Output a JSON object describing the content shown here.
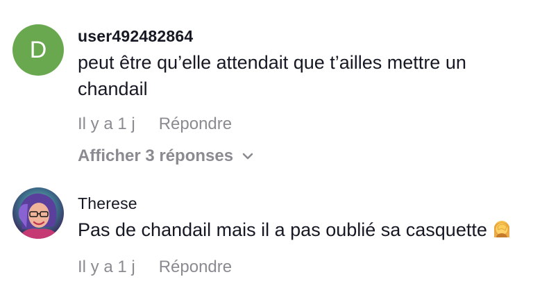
{
  "comments": [
    {
      "avatar_letter": "D",
      "avatar_color": "#6aa84f",
      "username": "user492482864",
      "text": "peut être qu’elle attendait que t’ailles mettre un chandail",
      "time": "Il y a 1 j",
      "reply_label": "Répondre",
      "view_replies": "Afficher 3 réponses",
      "replies_icon": "chevron-down-icon"
    },
    {
      "avatar_icon": "profile-photo",
      "username": "Therese",
      "text": "Pas de chandail mais il a pas oublié sa casquette",
      "emoji_icon": "person-facepalming-emoji",
      "time": "Il y a 1 j",
      "reply_label": "Répondre"
    }
  ]
}
